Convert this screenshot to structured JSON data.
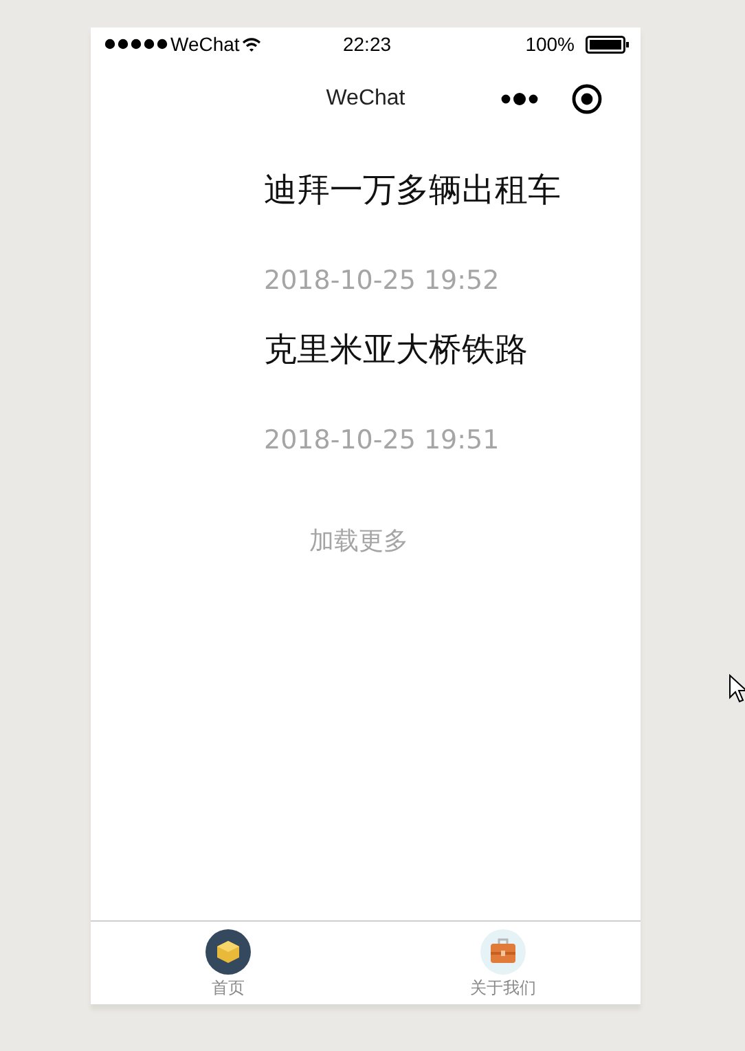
{
  "status_bar": {
    "carrier": "WeChat",
    "time": "22:23",
    "battery": "100%"
  },
  "nav_bar": {
    "title": "WeChat"
  },
  "articles": [
    {
      "title": "迪拜一万多辆出租车",
      "date": "2018-10-25 19:52"
    },
    {
      "title": "克里米亚大桥铁路",
      "date": "2018-10-25 19:51"
    }
  ],
  "load_more": "加载更多",
  "tab_bar": [
    {
      "label": "首页",
      "selected": true,
      "kind": "box"
    },
    {
      "label": "关于我们",
      "selected": false,
      "kind": "briefcase"
    }
  ]
}
